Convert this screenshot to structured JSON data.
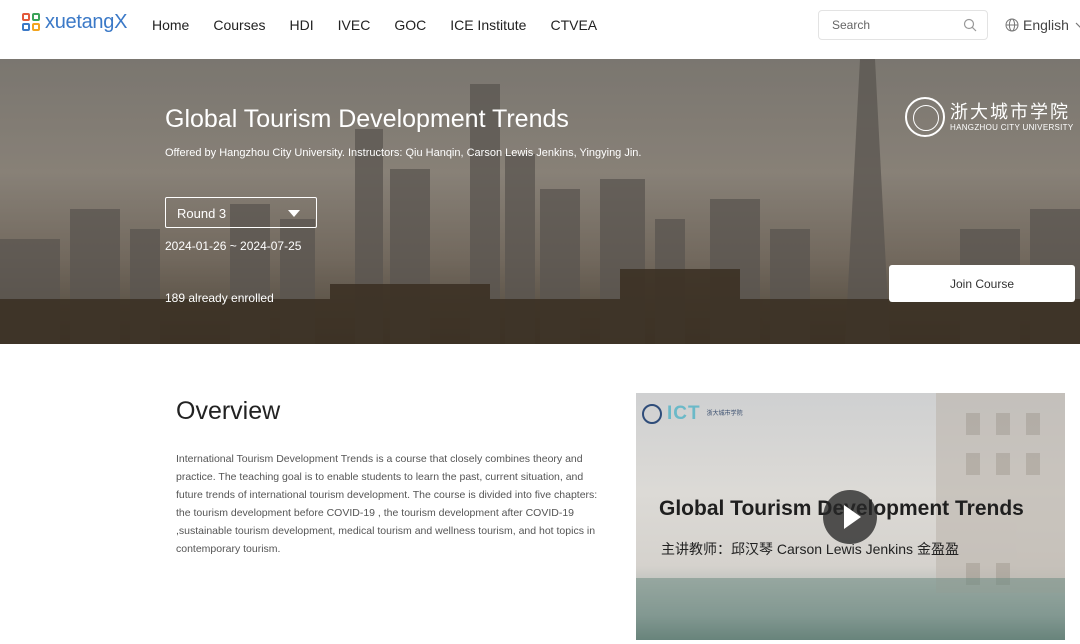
{
  "brand": {
    "name": "xuetangX",
    "color": "#3b79c7"
  },
  "nav": {
    "items": [
      "Home",
      "Courses",
      "HDI",
      "IVEC",
      "GOC",
      "ICE Institute",
      "CTVEA"
    ]
  },
  "search": {
    "placeholder": "Search"
  },
  "language": {
    "label": "English"
  },
  "hero": {
    "title": "Global Tourism Development Trends",
    "subtitle": "Offered by Hangzhou City University. Instructors: Qiu Hanqin, Carson Lewis Jenkins, Yingying Jin.",
    "round": "Round 3",
    "dates": "2024-01-26 ~ 2024-07-25",
    "enrolled": "189 already enrolled",
    "join_label": "Join Course",
    "university_cn": "浙大城市学院",
    "university_en": "HANGZHOU CITY UNIVERSITY"
  },
  "overview": {
    "title": "Overview",
    "body": "International Tourism Development Trends is a course that closely combines theory and practice. The teaching goal is to enable students to learn the past, current situation, and future trends of international tourism development. The course is divided into five chapters: the tourism development before COVID-19 , the tourism development after COVID-19 ,sustainable tourism development, medical tourism and wellness tourism, and hot topics in contemporary tourism."
  },
  "video": {
    "title": "Global Tourism Development Trends",
    "instructors": "主讲教师：邱汉琴  Carson Lewis Jenkins  金盈盈",
    "header_mark": "ICT",
    "header_text_cn": "浙大城市学院",
    "play_icon": "play-icon"
  }
}
